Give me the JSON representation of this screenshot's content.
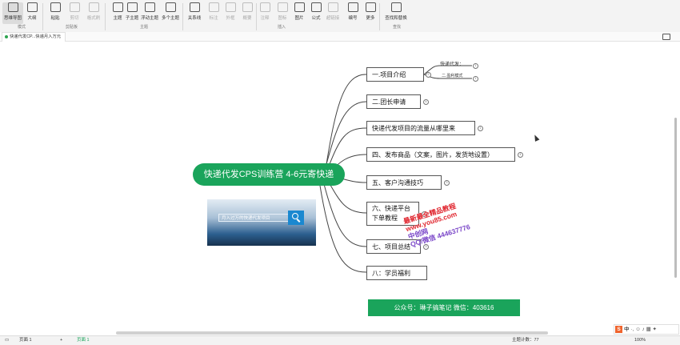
{
  "ribbon": {
    "tools": [
      {
        "id": "mindmap",
        "label": "思维导图",
        "active": true
      },
      {
        "id": "outline",
        "label": "大纲"
      },
      {
        "id": "paste",
        "label": "粘贴"
      },
      {
        "id": "cut",
        "label": "剪切",
        "disabled": true
      },
      {
        "id": "copy",
        "label": "拷贝",
        "disabled": true
      },
      {
        "id": "format",
        "label": "格式刷",
        "disabled": true
      },
      {
        "id": "topic",
        "label": "主题"
      },
      {
        "id": "subtopic",
        "label": "子主题"
      },
      {
        "id": "floating",
        "label": "浮动主题"
      },
      {
        "id": "multi",
        "label": "多个主题"
      },
      {
        "id": "relation",
        "label": "关系线"
      },
      {
        "id": "callout",
        "label": "标注",
        "disabled": true
      },
      {
        "id": "outer",
        "label": "外框",
        "disabled": true
      },
      {
        "id": "summary",
        "label": "概要",
        "disabled": true
      },
      {
        "id": "note",
        "label": "注释",
        "disabled": true
      },
      {
        "id": "icon",
        "label": "图标",
        "disabled": true
      },
      {
        "id": "image",
        "label": "图片"
      },
      {
        "id": "formula",
        "label": "公式"
      },
      {
        "id": "link",
        "label": "超链接",
        "disabled": true
      },
      {
        "id": "number",
        "label": "编号"
      },
      {
        "id": "more",
        "label": "更多"
      },
      {
        "id": "find",
        "label": "查找和替换"
      }
    ],
    "groups": {
      "mode": "模式",
      "clipboard": "剪贴板",
      "topic": "主题",
      "insert": "插入",
      "find": "查找"
    }
  },
  "tab": {
    "title": "快递代发CP...快递月入万元"
  },
  "mindmap": {
    "root": "快递代发CPS训练营 4-6元寄快递",
    "nodes": [
      {
        "id": "n1",
        "text": "一.项目介绍",
        "count": "2"
      },
      {
        "id": "n2",
        "text": "二.团长申请",
        "count": "4"
      },
      {
        "id": "n3",
        "text": "快递代发项目的流量从哪里来",
        "count": "1"
      },
      {
        "id": "n4",
        "text": "四、发布商品（文案，图片，发货地设置）",
        "count": "4"
      },
      {
        "id": "n5",
        "text": "五、客户沟通技巧",
        "count": "3"
      },
      {
        "id": "n6",
        "text": "六、快递平台下单教程",
        "count": "3"
      },
      {
        "id": "n7",
        "text": "七、项目总结",
        "count": "3"
      },
      {
        "id": "n8",
        "text": "八：学员福利"
      }
    ],
    "sub": [
      {
        "text": "快递代发：",
        "count": "1"
      },
      {
        "text": "二.盈利模式",
        "count": "1"
      }
    ],
    "banner": "月入过万的快递代发项目",
    "footer": "公众号：琳子搞笔记      微信：403616"
  },
  "watermark": {
    "line1": "最新最全精品教程",
    "line2": "www.you85.com",
    "line3": "中创网",
    "line4": "QQ/微信 444637776"
  },
  "status": {
    "page": "页面 1",
    "add": "+",
    "active_page": "页面 1",
    "topic_count": "主题计数：77",
    "zoom": "100%",
    "ime": "中"
  }
}
